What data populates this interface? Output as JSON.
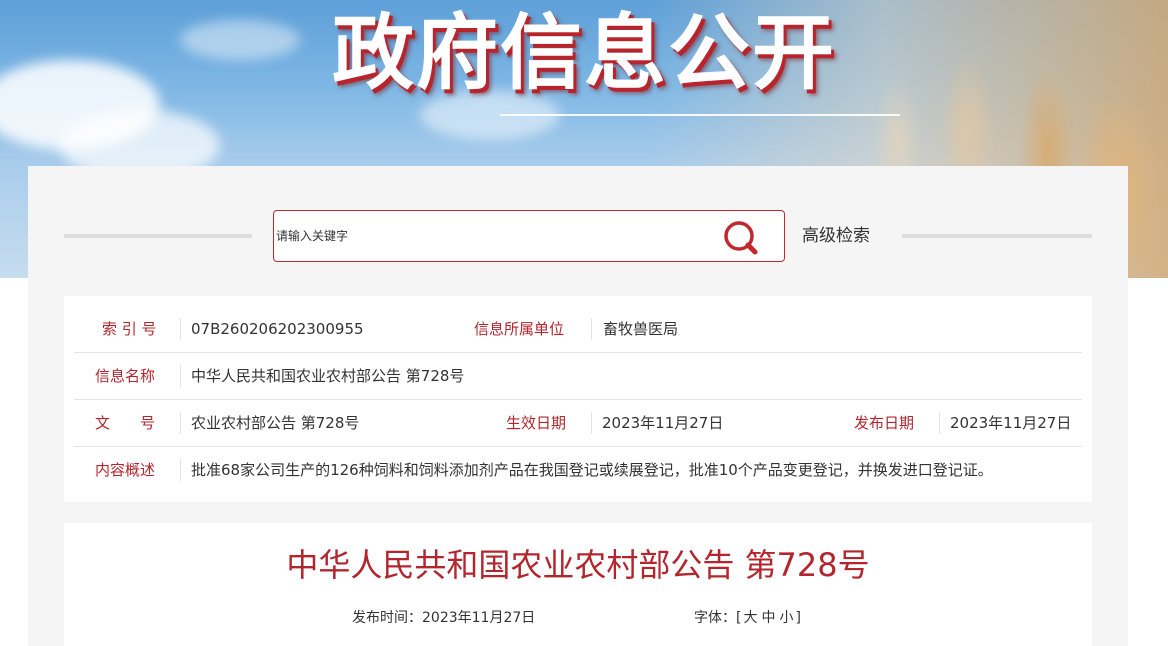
{
  "banner": {
    "title": "政府信息公开"
  },
  "search": {
    "placeholder": "请输入关键字",
    "button_icon": "search-icon",
    "advanced_label": "高级检索"
  },
  "info": {
    "index_label": "索 引 号",
    "index_value": "07B260206202300955",
    "unit_label": "信息所属单位",
    "unit_value": "畜牧兽医局",
    "name_label": "信息名称",
    "name_value": "中华人民共和国农业农村部公告 第728号",
    "doc_label": "文　　号",
    "doc_value": "农业农村部公告 第728号",
    "effective_label": "生效日期",
    "effective_value": "2023年11月27日",
    "publish_label": "发布日期",
    "publish_value": "2023年11月27日",
    "summary_label": "内容概述",
    "summary_value": "批准68家公司生产的126种饲料和饲料添加剂产品在我国登记或续展登记，批准10个产品变更登记，并换发进口登记证。"
  },
  "article": {
    "title": "中华人民共和国农业农村部公告 第728号",
    "publish_time_label": "发布时间：",
    "publish_time_value": "2023年11月27日",
    "font_label": "字体：",
    "font_open": "[",
    "font_large": "大",
    "font_medium": "中",
    "font_small": "小",
    "font_close": "]"
  },
  "colors": {
    "accent_red": "#b3262d",
    "search_border": "#c1272d"
  }
}
